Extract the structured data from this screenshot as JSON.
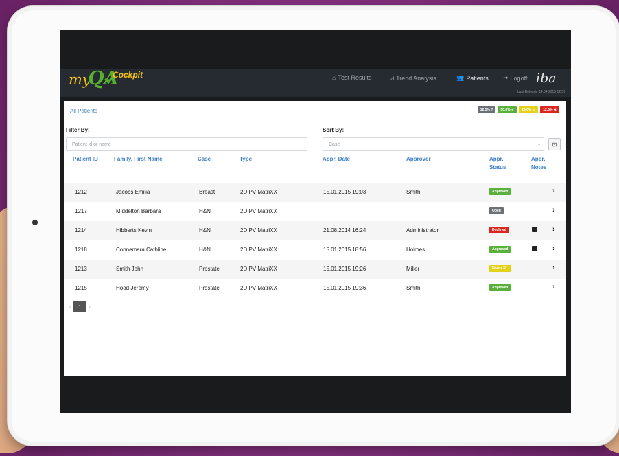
{
  "app": {
    "logo": {
      "my": "my",
      "qa": "QA",
      "cockpit": "Cockpit"
    },
    "brand": "iba",
    "last_refresh": "Last Refresh: 14.04.2015 12:59"
  },
  "nav": [
    {
      "label": "Test Results",
      "icon": "home-icon",
      "active": false
    },
    {
      "label": "Trend Analysis",
      "icon": "chart-icon",
      "active": false
    },
    {
      "label": "Patients",
      "icon": "users-icon",
      "active": true
    },
    {
      "label": "Logoff",
      "icon": "logoff-icon",
      "active": false
    }
  ],
  "breadcrumb": "All Patients",
  "stats": [
    {
      "label": "12.5% ?",
      "color": "#6c7178"
    },
    {
      "label": "50.0% ✔",
      "color": "#59b13c"
    },
    {
      "label": "25.0% ⚠",
      "color": "#e4d21a"
    },
    {
      "label": "12.5% ✖",
      "color": "#d9261f"
    }
  ],
  "filter": {
    "label": "Filter By:",
    "placeholder": "Patient id or name"
  },
  "sort": {
    "label": "Sort By:",
    "placeholder": "Case"
  },
  "columns": [
    "Patient ID",
    "Family, First Name",
    "Case",
    "Type",
    "Appr. Date",
    "Approver",
    "Appr. Status",
    "Appr. Notes"
  ],
  "rows": [
    {
      "id": "1212",
      "name": "Jacobs Emilia",
      "case": "Breast",
      "type": "2D PV MatriXX",
      "date": "15.01.2015 19:03",
      "approver": "Smith",
      "status": "Approved",
      "status_color": "#59b13c",
      "note": false
    },
    {
      "id": "1217",
      "name": "Middelton Barbara",
      "case": "H&N",
      "type": "2D PV MatriXX",
      "date": "",
      "approver": "",
      "status": "Open",
      "status_color": "#6c7178",
      "note": false
    },
    {
      "id": "1214",
      "name": "Hibberts Kevin",
      "case": "H&N",
      "type": "2D PV MatriXX",
      "date": "21.08.2014 16:24",
      "approver": "Administrator",
      "status": "Declined",
      "status_color": "#d9261f",
      "note": true
    },
    {
      "id": "1218",
      "name": "Connemara Cathline",
      "case": "H&N",
      "type": "2D PV MatriXX",
      "date": "15.01.2015 18:56",
      "approver": "Holmes",
      "status": "Approved",
      "status_color": "#59b13c",
      "note": true
    },
    {
      "id": "1213",
      "name": "Smith John",
      "case": "Prostate",
      "type": "2D PV MatriXX",
      "date": "15.01.2015 19:26",
      "approver": "Miller",
      "status": "Needs R...",
      "status_color": "#e4d21a",
      "note": false
    },
    {
      "id": "1215",
      "name": "Hood Jeremy",
      "case": "Prostate",
      "type": "2D PV MatriXX",
      "date": "15.01.2015 19:36",
      "approver": "Smith",
      "status": "Approved",
      "status_color": "#59b13c",
      "note": false
    }
  ],
  "pager": {
    "prev": "‹",
    "current": "1",
    "next": "›"
  }
}
